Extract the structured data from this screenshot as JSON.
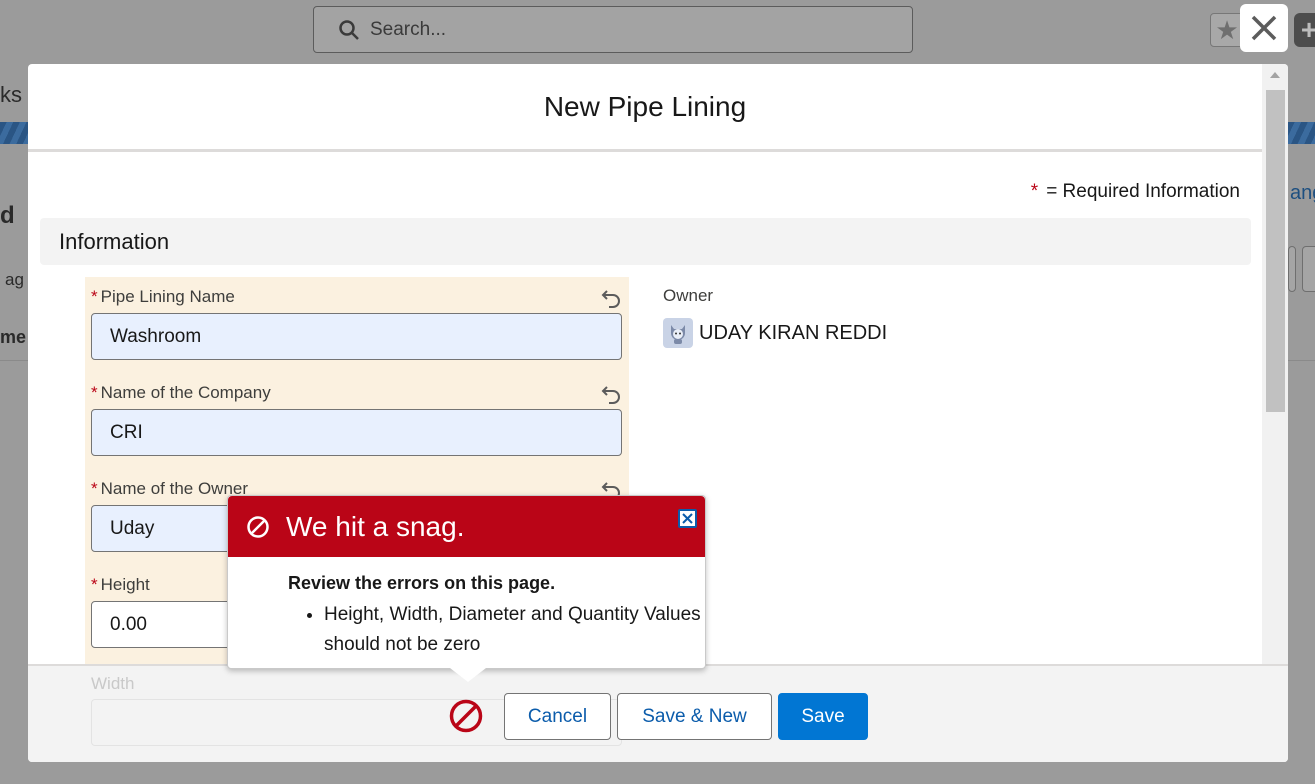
{
  "background": {
    "search_placeholder": "Search...",
    "frag_ks": "ks",
    "frag_d": "d",
    "frag_ag": "ag",
    "frag_me": "me",
    "frag_ang": "ang"
  },
  "modal": {
    "title": "New Pipe Lining",
    "required_legend": "= Required Information",
    "required_star": "*",
    "section_title": "Information",
    "fields": [
      {
        "label": "Pipe Lining Name",
        "value": "Washroom"
      },
      {
        "label": "Name of the Company",
        "value": "CRI"
      },
      {
        "label": "Name of the Owner",
        "value": "Uday"
      },
      {
        "label": "Height",
        "value": "0.00"
      },
      {
        "label": "Width",
        "value": ""
      }
    ],
    "owner": {
      "label": "Owner",
      "name": "UDAY KIRAN REDDI"
    }
  },
  "error_popover": {
    "title": "We hit a snag.",
    "subtitle": "Review the errors on this page.",
    "errors": [
      "Height, Width, Diameter and Quantity Values should not be zero"
    ]
  },
  "footer": {
    "cancel_label": "Cancel",
    "save_new_label": "Save & New",
    "save_label": "Save"
  },
  "colors": {
    "error_red": "#ba0517",
    "brand_blue": "#0176d3",
    "link_blue": "#0b5cab",
    "required_bg": "#fbf1e0"
  }
}
